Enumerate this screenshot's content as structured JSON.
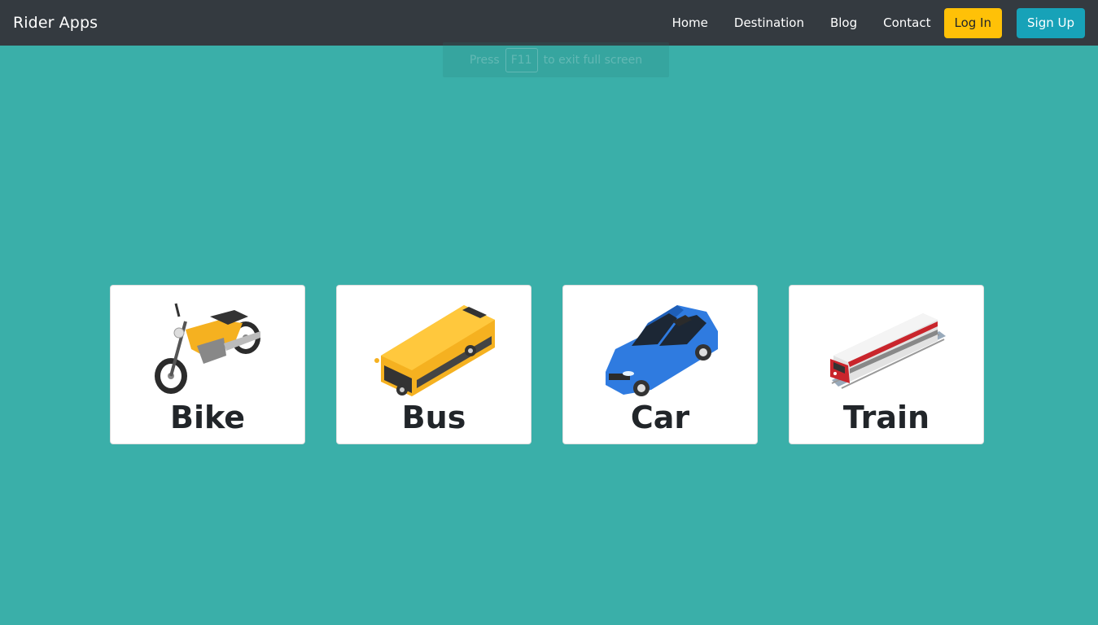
{
  "navbar": {
    "brand": "Rider Apps",
    "links": [
      "Home",
      "Destination",
      "Blog",
      "Contact"
    ],
    "login_label": "Log In",
    "signup_label": "Sign Up"
  },
  "fullscreen_hint": {
    "prefix": "Press",
    "key": "F11",
    "suffix": "to exit full screen"
  },
  "colors": {
    "background": "#3aafa9",
    "navbar": "#343a40",
    "login": "#ffc107",
    "signup": "#17a2b8"
  },
  "cards": [
    {
      "title": "Bike",
      "icon": "motorbike-icon"
    },
    {
      "title": "Bus",
      "icon": "bus-icon"
    },
    {
      "title": "Car",
      "icon": "car-icon"
    },
    {
      "title": "Train",
      "icon": "train-icon"
    }
  ]
}
